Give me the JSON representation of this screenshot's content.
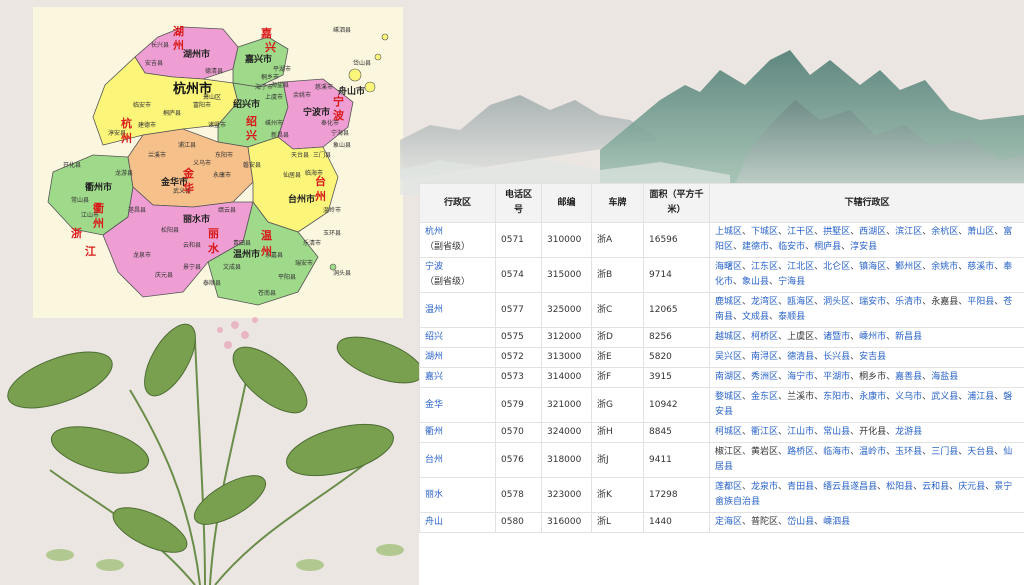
{
  "map": {
    "cities": [
      "湖州市",
      "嘉兴市",
      "杭州市",
      "舟山市",
      "绍兴市",
      "宁波市",
      "衢州市",
      "金华市",
      "台州市",
      "丽水市",
      "温州市"
    ],
    "counties": [
      "长兴县",
      "安吉县",
      "德清县",
      "桐乡市",
      "海宁市",
      "平湖市",
      "海盐县",
      "嵊泗县",
      "岱山县",
      "临安市",
      "淳安县",
      "建德市",
      "桐庐县",
      "富阳市",
      "萧山区",
      "诸暨市",
      "上虞市",
      "余姚市",
      "慈溪市",
      "奉化市",
      "宁海县",
      "象山县",
      "嵊州市",
      "新昌县",
      "三门县",
      "天台县",
      "仙居县",
      "临海市",
      "开化县",
      "常山县",
      "江山市",
      "龙游县",
      "兰溪市",
      "浦江县",
      "义乌市",
      "东阳市",
      "武义县",
      "永康市",
      "磐安县",
      "缙云县",
      "遂昌县",
      "松阳县",
      "龙泉市",
      "庆元县",
      "景宁县",
      "云和县",
      "青田县",
      "文成县",
      "泰顺县",
      "平阳县",
      "苍南县",
      "瑞安市",
      "永嘉县",
      "乐清市",
      "玉环县",
      "温岭市",
      "洞头县"
    ],
    "deco": [
      "浙",
      "江",
      "杭",
      "州",
      "嘉",
      "兴",
      "绍",
      "兴",
      "宁",
      "波",
      "衢",
      "州",
      "金",
      "华",
      "台",
      "州",
      "丽",
      "水",
      "温",
      "州",
      "湖",
      "州"
    ]
  },
  "table": {
    "headers": [
      "行政区",
      "电话区号",
      "邮编",
      "车牌",
      "面积（平方千米）",
      "下辖行政区"
    ],
    "rows": [
      {
        "name": "杭州",
        "sub": "（副省级）",
        "tel": "0571",
        "zip": "310000",
        "plate": "浙A",
        "area": "16596",
        "districts": [
          [
            "上城区",
            1
          ],
          [
            "下城区",
            1
          ],
          [
            "江干区",
            1
          ],
          [
            "拱墅区",
            1
          ],
          [
            "西湖区",
            1
          ],
          [
            "滨江区",
            1
          ],
          [
            "余杭区",
            1
          ],
          [
            "萧山区",
            1
          ],
          [
            "富阳区",
            1
          ],
          [
            "建德市",
            1
          ],
          [
            "临安市",
            1
          ],
          [
            "桐庐县",
            1
          ],
          [
            "淳安县",
            1
          ]
        ]
      },
      {
        "name": "宁波",
        "sub": "（副省级）",
        "tel": "0574",
        "zip": "315000",
        "plate": "浙B",
        "area": "9714",
        "districts": [
          [
            "海曙区",
            1
          ],
          [
            "江东区",
            1
          ],
          [
            "江北区",
            1
          ],
          [
            "北仑区",
            1
          ],
          [
            "镇海区",
            1
          ],
          [
            "鄞州区",
            1
          ],
          [
            "余姚市",
            1
          ],
          [
            "慈溪市",
            1
          ],
          [
            "奉化市",
            1
          ],
          [
            "象山县",
            1
          ],
          [
            "宁海县",
            1
          ]
        ]
      },
      {
        "name": "温州",
        "sub": "",
        "tel": "0577",
        "zip": "325000",
        "plate": "浙C",
        "area": "12065",
        "districts": [
          [
            "鹿城区",
            1
          ],
          [
            "龙湾区",
            1
          ],
          [
            "瓯海区",
            1
          ],
          [
            "洞头区",
            1
          ],
          [
            "瑞安市",
            1
          ],
          [
            "乐清市",
            1
          ],
          [
            "永嘉县",
            0
          ],
          [
            "平阳县",
            1
          ],
          [
            "苍南县",
            1
          ],
          [
            "文成县",
            1
          ],
          [
            "泰顺县",
            1
          ]
        ]
      },
      {
        "name": "绍兴",
        "sub": "",
        "tel": "0575",
        "zip": "312000",
        "plate": "浙D",
        "area": "8256",
        "districts": [
          [
            "越城区",
            1
          ],
          [
            "柯桥区",
            1
          ],
          [
            "上虞区",
            0
          ],
          [
            "诸暨市",
            1
          ],
          [
            "嵊州市",
            1
          ],
          [
            "新昌县",
            1
          ]
        ]
      },
      {
        "name": "湖州",
        "sub": "",
        "tel": "0572",
        "zip": "313000",
        "plate": "浙E",
        "area": "5820",
        "districts": [
          [
            "吴兴区",
            1
          ],
          [
            "南浔区",
            1
          ],
          [
            "德清县",
            1
          ],
          [
            "长兴县",
            1
          ],
          [
            "安吉县",
            1
          ]
        ]
      },
      {
        "name": "嘉兴",
        "sub": "",
        "tel": "0573",
        "zip": "314000",
        "plate": "浙F",
        "area": "3915",
        "districts": [
          [
            "南湖区",
            1
          ],
          [
            "秀洲区",
            1
          ],
          [
            "海宁市",
            1
          ],
          [
            "平湖市",
            1
          ],
          [
            "桐乡市",
            0
          ],
          [
            "嘉善县",
            1
          ],
          [
            "海盐县",
            1
          ]
        ]
      },
      {
        "name": "金华",
        "sub": "",
        "tel": "0579",
        "zip": "321000",
        "plate": "浙G",
        "area": "10942",
        "districts": [
          [
            "婺城区",
            1
          ],
          [
            "金东区",
            1
          ],
          [
            "兰溪市",
            0
          ],
          [
            "东阳市",
            1
          ],
          [
            "永康市",
            1
          ],
          [
            "义乌市",
            1
          ],
          [
            "武义县",
            1
          ],
          [
            "浦江县",
            1
          ],
          [
            "磐安县",
            1
          ]
        ]
      },
      {
        "name": "衢州",
        "sub": "",
        "tel": "0570",
        "zip": "324000",
        "plate": "浙H",
        "area": "8845",
        "districts": [
          [
            "柯城区",
            1
          ],
          [
            "衢江区",
            1
          ],
          [
            "江山市",
            1
          ],
          [
            "常山县",
            1
          ],
          [
            "开化县",
            0
          ],
          [
            "龙游县",
            1
          ]
        ]
      },
      {
        "name": "台州",
        "sub": "",
        "tel": "0576",
        "zip": "318000",
        "plate": "浙J",
        "area": "9411",
        "districts": [
          [
            "椒江区",
            0
          ],
          [
            "黄岩区",
            0
          ],
          [
            "路桥区",
            1
          ],
          [
            "临海市",
            1
          ],
          [
            "温岭市",
            1
          ],
          [
            "玉环县",
            1
          ],
          [
            "三门县",
            1
          ],
          [
            "天台县",
            1
          ],
          [
            "仙居县",
            1
          ]
        ]
      },
      {
        "name": "丽水",
        "sub": "",
        "tel": "0578",
        "zip": "323000",
        "plate": "浙K",
        "area": "17298",
        "districts": [
          [
            "莲都区",
            1
          ],
          [
            "龙泉市",
            1
          ],
          [
            "青田县",
            1
          ],
          [
            "缙云县遂昌县",
            1
          ],
          [
            "松阳县",
            1
          ],
          [
            "云和县",
            1
          ],
          [
            "庆元县",
            1
          ],
          [
            "景宁畲族自治县",
            1
          ]
        ]
      },
      {
        "name": "舟山",
        "sub": "",
        "tel": "0580",
        "zip": "316000",
        "plate": "浙L",
        "area": "1440",
        "districts": [
          [
            "定海区",
            1
          ],
          [
            "普陀区",
            0
          ],
          [
            "岱山县",
            1
          ],
          [
            "嵊泗县",
            1
          ]
        ]
      }
    ]
  },
  "colors": {
    "link": "#2a63c8",
    "pink": "#ee9ed2",
    "yellow": "#fbf57a",
    "green": "#9fd98a",
    "orange": "#f6c08a",
    "paper": "#fbf7df"
  }
}
